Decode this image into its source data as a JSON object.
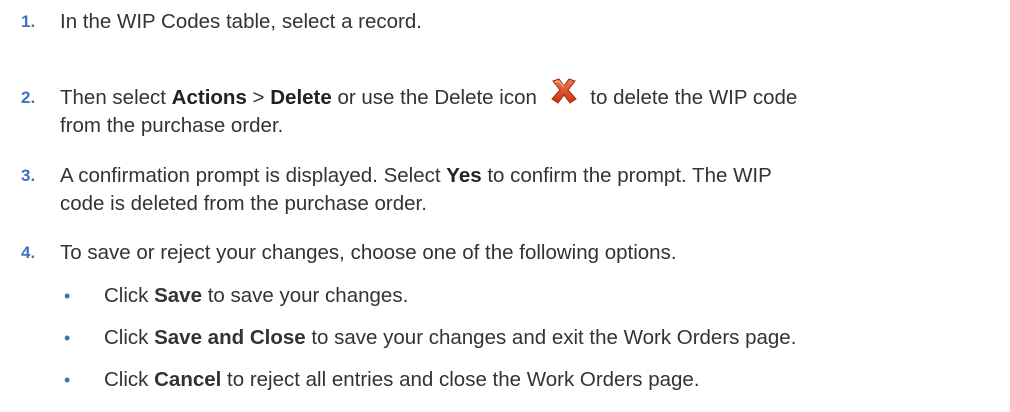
{
  "steps": [
    {
      "number": "1.",
      "text": "In the WIP Codes table, select a record."
    },
    {
      "number": "2.",
      "pre": "Then select ",
      "b1": "Actions",
      "mid1": " > ",
      "b2": "Delete",
      "mid2": " or use the Delete icon ",
      "post_line1": " to delete the WIP code",
      "line2": "from the purchase order."
    },
    {
      "number": "3.",
      "pre": "A confirmation prompt is displayed. Select ",
      "b1": "Yes",
      "post_line1": " to confirm the prompt. The WIP",
      "line2": "code is deleted from the purchase order."
    },
    {
      "number": "4.",
      "text": "To save or reject your changes, choose one of the following options."
    }
  ],
  "bullets": [
    {
      "bullet": "•",
      "pre": "Click ",
      "bold": "Save",
      "post": " to save your changes."
    },
    {
      "bullet": "•",
      "pre": "Click ",
      "bold": "Save and Close",
      "post": " to save your changes and exit the Work Orders page."
    },
    {
      "bullet": "•",
      "pre": "Click ",
      "bold": "Cancel",
      "post": " to reject all entries and close the Work Orders page."
    }
  ],
  "icons": {
    "delete": "delete-x-icon",
    "delete_color": "#d8411c"
  }
}
